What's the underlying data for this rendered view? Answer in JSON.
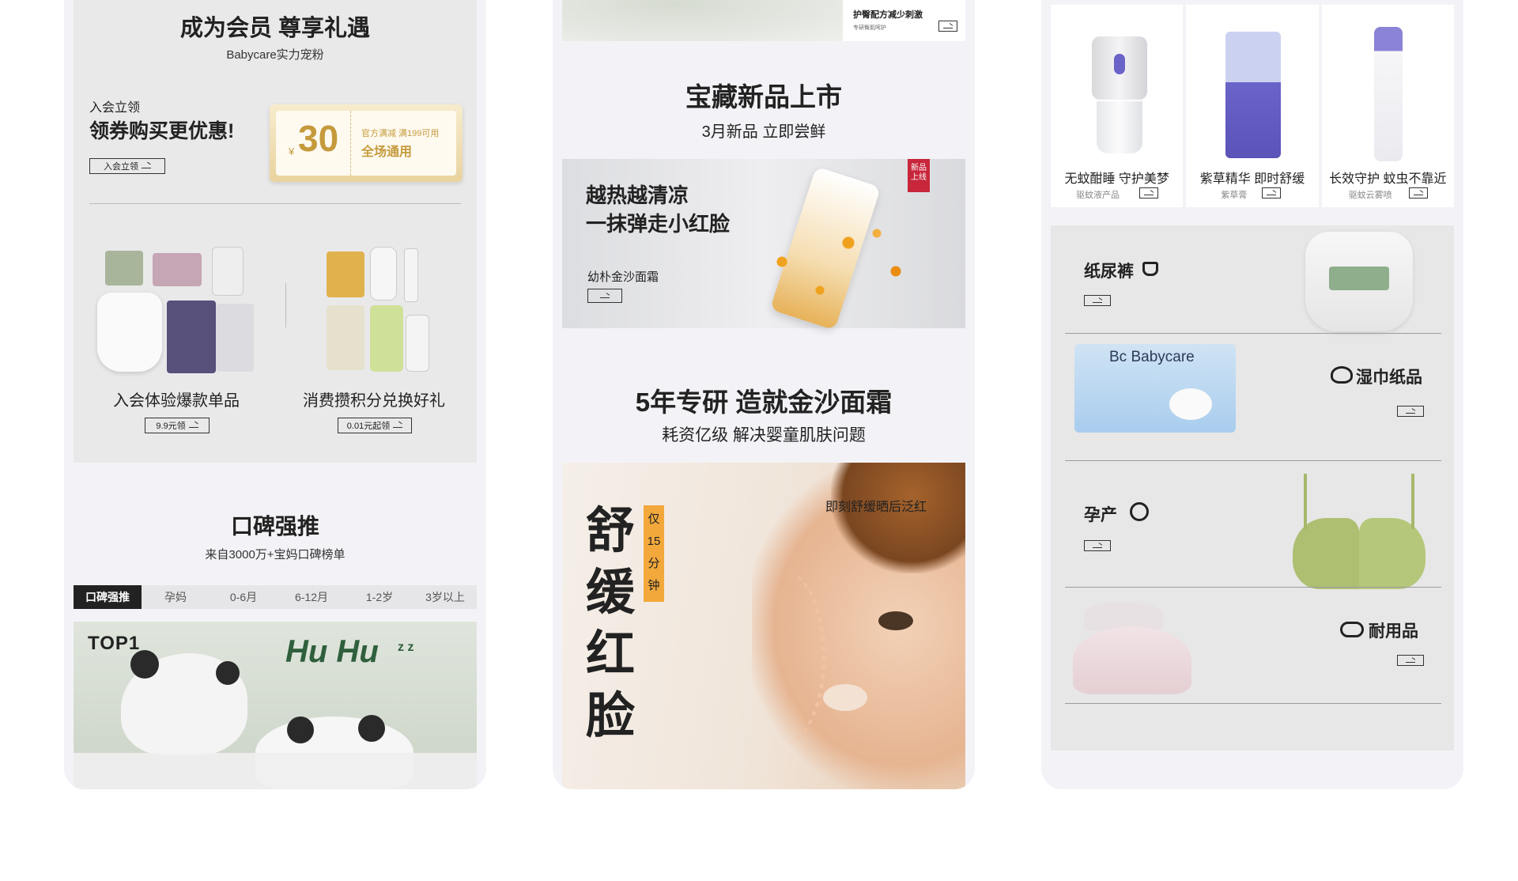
{
  "col1": {
    "member_title": "成为会员 尊享礼遇",
    "member_sub": "Babycare实力宠粉",
    "coupon_intro_small": "入会立领",
    "coupon_intro_big": "领券购买更优惠!",
    "join_button": "入会立领",
    "coupon": {
      "currency": "¥",
      "amount": "30",
      "line1": "官方满减 满199可用",
      "line2": "全场通用"
    },
    "gift_left": {
      "title": "入会体验爆款单品",
      "button": "9.9元领"
    },
    "gift_right": {
      "title": "消费攒积分兑换好礼",
      "button": "0.01元起领"
    },
    "reviews_title": "口碑强推",
    "reviews_sub": "来自3000万+宝妈口碑榜单",
    "tabs": [
      "口碑强推",
      "孕妈",
      "0-6月",
      "6-12月",
      "1-2岁",
      "3岁以上"
    ],
    "banner_top": "TOP1",
    "banner_script": "Hu Hu",
    "banner_zz": "z z"
  },
  "col2": {
    "top_product_name": "护臀配方减少刺激",
    "top_product_sub": "专研臀肌呵护",
    "new_title": "宝藏新品上市",
    "new_sub": "3月新品 立即尝鲜",
    "banner_head1": "越热越清凉",
    "banner_head2": "一抹弹走小红脸",
    "banner_product": "幼朴金沙面霜",
    "new_tag": "新品上线",
    "research_title": "5年专研 造就金沙面霜",
    "research_sub": "耗资亿级 解决婴童肌肤问题",
    "face_vertical": [
      "舒",
      "缓",
      "红",
      "脸"
    ],
    "face_tag": [
      "仅",
      "15",
      "分",
      "钟"
    ],
    "face_caption": "即刻舒缓晒后泛红"
  },
  "col3": {
    "products": [
      {
        "title": "无蚊酣睡 守护美梦",
        "sub": "驱蚊液产品"
      },
      {
        "title": "紫草精华 即时舒缓",
        "sub": "紫草膏"
      },
      {
        "title": "长效守护 蚊虫不靠近",
        "sub": "驱蚊云雾喷"
      }
    ],
    "categories": [
      {
        "label": "纸尿裤"
      },
      {
        "label": "湿巾纸品"
      },
      {
        "label": "孕产"
      },
      {
        "label": "耐用品"
      }
    ],
    "wipes_brand": "Bc Babycare"
  },
  "colors": {
    "bg": "#f3f3f7",
    "card": "#e9e9ea",
    "gold": "#c59a3c",
    "orange": "#f3a83b",
    "red": "#c8263b",
    "purple": "#6a63c8"
  }
}
